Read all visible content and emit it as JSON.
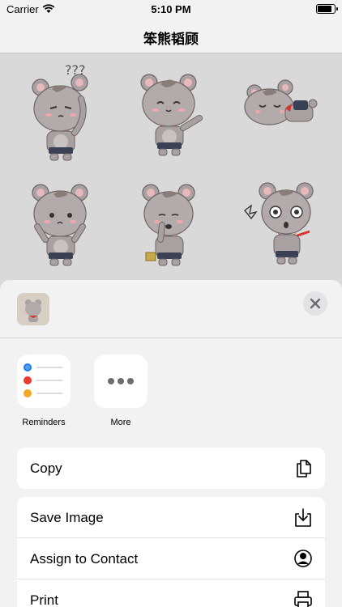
{
  "status_bar": {
    "carrier": "Carrier",
    "time": "5:10 PM",
    "battery_level": 0.9
  },
  "nav": {
    "title": "笨熊韬顾"
  },
  "stickers": [
    "bear-confused",
    "bear-waving",
    "bear-lying",
    "bear-sad",
    "bear-eating",
    "bear-surprised"
  ],
  "share_apps": [
    {
      "label": "Reminders",
      "icon": "reminders-icon"
    },
    {
      "label": "More",
      "icon": "more-icon"
    }
  ],
  "actions": {
    "copy": "Copy",
    "save_image": "Save Image",
    "assign_contact": "Assign to Contact",
    "print": "Print"
  },
  "colors": {
    "reminder_dots": [
      "#1a7cf2",
      "#ea3b2e",
      "#f5a623"
    ]
  }
}
